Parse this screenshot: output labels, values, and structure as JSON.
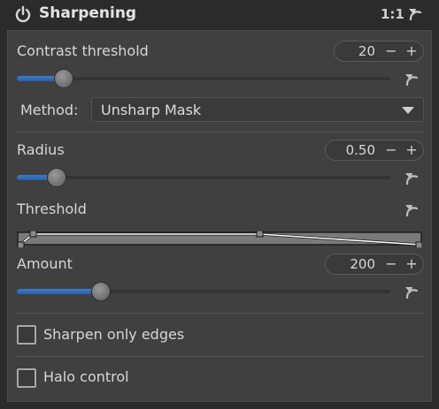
{
  "header": {
    "title": "Sharpening",
    "ratio": "1:1",
    "power_icon": "power-icon",
    "reset_icon": "reset-icon"
  },
  "contrast_threshold": {
    "label": "Contrast threshold",
    "value": "20",
    "minus": "−",
    "plus": "+",
    "level": 0.1
  },
  "method": {
    "label": "Method:",
    "value": "Unsharp Mask"
  },
  "radius": {
    "label": "Radius",
    "value": "0.50",
    "minus": "−",
    "plus": "+",
    "level": 0.08
  },
  "threshold": {
    "label": "Threshold"
  },
  "amount": {
    "label": "Amount",
    "value": "200",
    "minus": "−",
    "plus": "+",
    "level": 0.2
  },
  "options": {
    "sharpen_only_edges": {
      "label": "Sharpen only edges",
      "checked": false
    },
    "halo_control": {
      "label": "Halo control",
      "checked": false
    }
  },
  "colors": {
    "accent": "#2f6ab8",
    "panel": "#404040",
    "background": "#2b2b2b"
  }
}
